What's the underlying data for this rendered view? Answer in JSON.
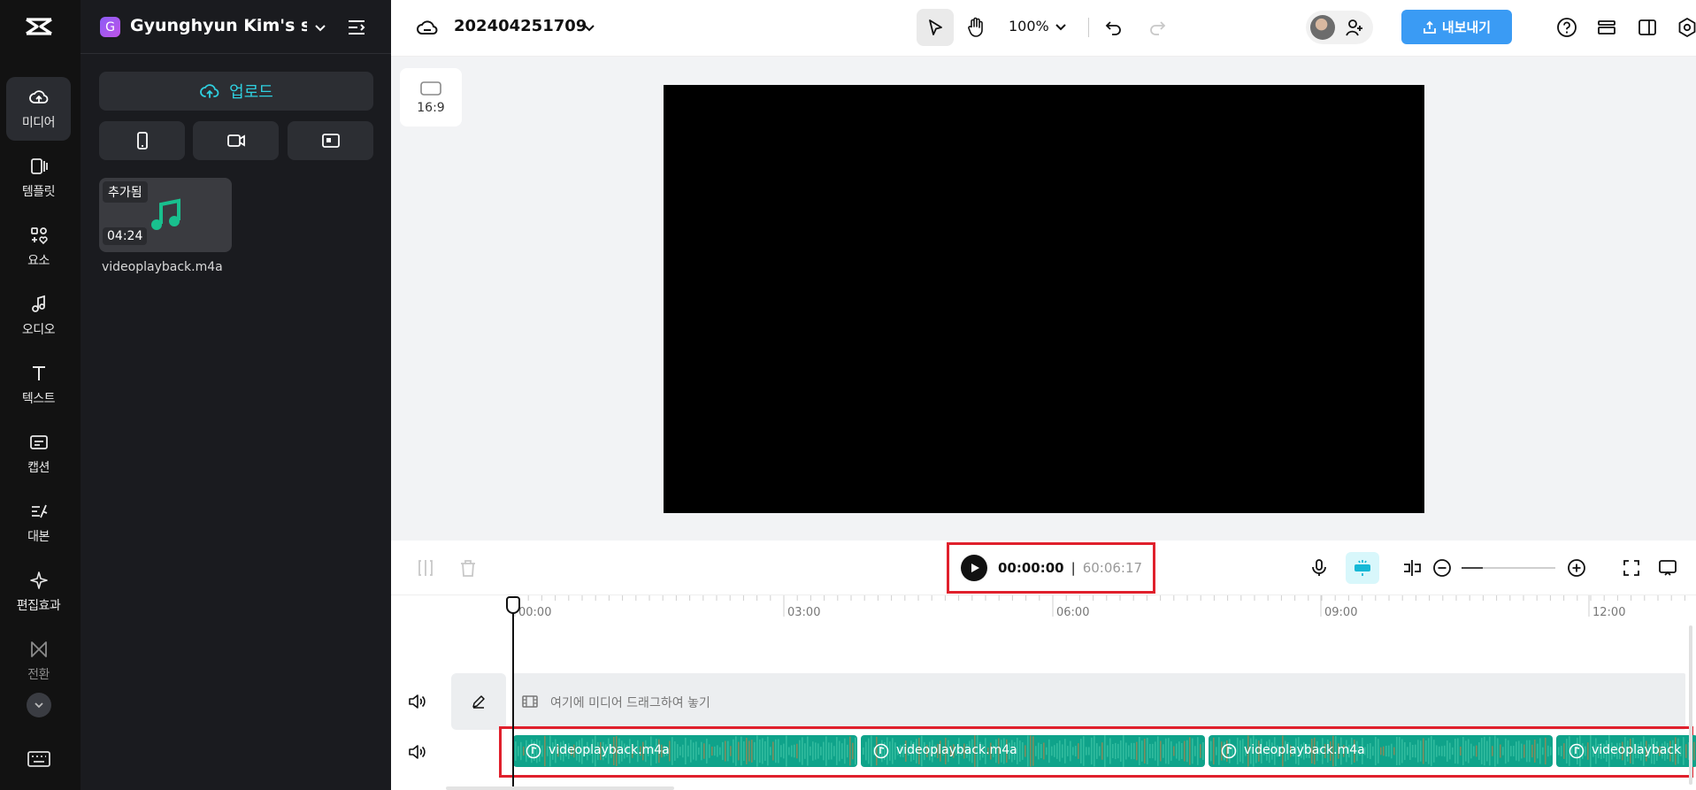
{
  "rail": {
    "items": [
      {
        "label": "미디어",
        "icon": "media-cloud-icon"
      },
      {
        "label": "템플릿",
        "icon": "template-icon"
      },
      {
        "label": "요소",
        "icon": "elements-icon"
      },
      {
        "label": "오디오",
        "icon": "music-note-icon"
      },
      {
        "label": "텍스트",
        "icon": "text-t-icon"
      },
      {
        "label": "캡션",
        "icon": "captions-icon"
      },
      {
        "label": "대본",
        "icon": "script-icon"
      },
      {
        "label": "편집효과",
        "icon": "effects-sparkle-icon"
      },
      {
        "label": "전환",
        "icon": "transition-icon"
      }
    ]
  },
  "panel": {
    "workspace_initial": "G",
    "workspace_name": "Gyunghyun Kim's s...",
    "upload_label": "업로드",
    "media": {
      "badge": "추가됨",
      "duration": "04:24",
      "name": "videoplayback.m4a"
    }
  },
  "topbar": {
    "project_title": "202404251709",
    "zoom": "100%",
    "export_label": "내보내기"
  },
  "canvas": {
    "ratio": "16:9",
    "background_color": "#000000"
  },
  "timeline": {
    "current_time": "00:00:00",
    "separator": "|",
    "total_time": "60:06:17",
    "ruler": [
      "00:00",
      "03:00",
      "06:00",
      "09:00",
      "12:00"
    ],
    "main_track_placeholder": "여기에 미디어 드래그하여 놓기",
    "audio_clips": [
      {
        "label": "videoplayback.m4a"
      },
      {
        "label": "videoplayback.m4a"
      },
      {
        "label": "videoplayback.m4a"
      },
      {
        "label": "videoplayback"
      }
    ]
  },
  "colors": {
    "accent": "#2fd0e0",
    "export": "#3a9bf4",
    "audio_clip": "#0fa38a",
    "highlight_box": "#e0202c"
  }
}
